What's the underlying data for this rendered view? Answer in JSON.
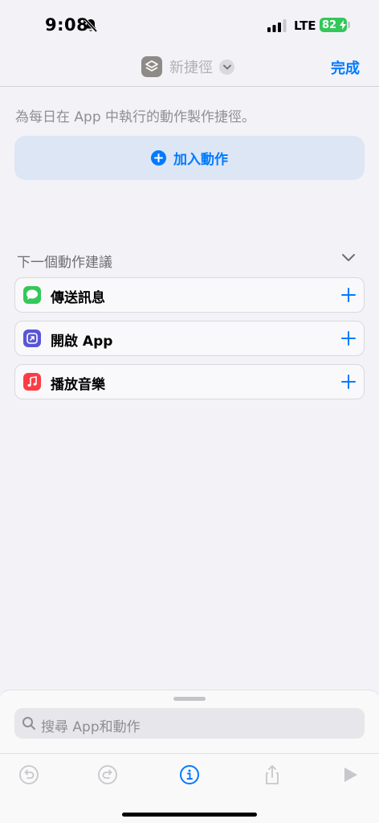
{
  "status": {
    "time": "9:08",
    "network": "LTE",
    "battery": "82"
  },
  "nav": {
    "title": "新捷徑",
    "done_label": "完成"
  },
  "main": {
    "hint": "為每日在 App 中執行的動作製作捷徑。",
    "add_action_label": "加入動作"
  },
  "suggestions": {
    "title": "下一個動作建議",
    "items": [
      {
        "label": "傳送訊息",
        "icon": "messages-icon",
        "color": "#34c759"
      },
      {
        "label": "開啟 App",
        "icon": "open-app-icon",
        "color": "#5856d6"
      },
      {
        "label": "播放音樂",
        "icon": "music-icon",
        "color": "#fc3c44"
      }
    ]
  },
  "search": {
    "placeholder": "搜尋 App和動作"
  },
  "toolbar": {
    "icons": [
      "undo-icon",
      "redo-icon",
      "info-icon",
      "share-icon",
      "play-icon"
    ],
    "accent": "#007aff"
  }
}
